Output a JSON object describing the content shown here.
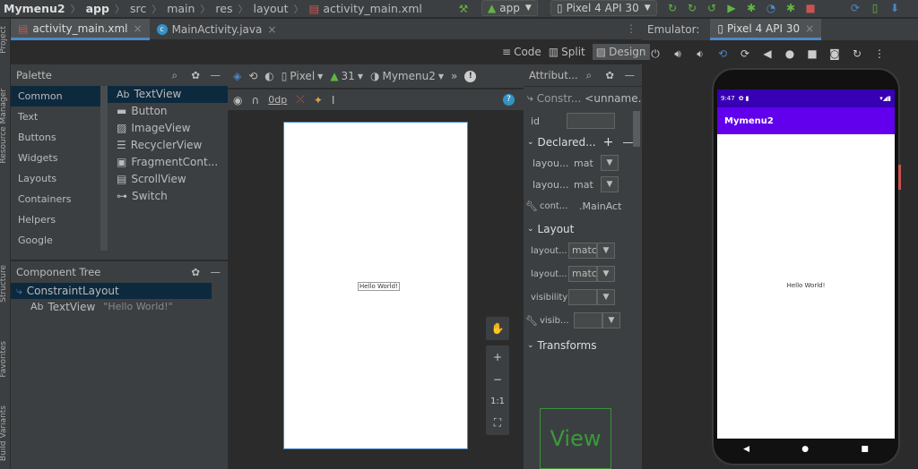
{
  "breadcrumb": {
    "project": "Mymenu2",
    "module": "app",
    "src": "src",
    "main": "main",
    "res": "res",
    "layout": "layout",
    "file": "activity_main.xml"
  },
  "run_config": "app",
  "device": "Pixel 4 API 30",
  "editor_tabs": [
    {
      "label": "activity_main.xml"
    },
    {
      "label": "MainActivity.java"
    }
  ],
  "view_modes": {
    "code": "Code",
    "split": "Split",
    "design": "Design"
  },
  "emulator": {
    "label": "Emulator:",
    "tab": "Pixel 4 API 30"
  },
  "side_labels": {
    "project": "Project",
    "resource_manager": "Resource Manager",
    "structure": "Structure",
    "favorites": "Favorites",
    "build_variants": "Build Variants"
  },
  "palette": {
    "title": "Palette",
    "categories": [
      "Common",
      "Text",
      "Buttons",
      "Widgets",
      "Layouts",
      "Containers",
      "Helpers",
      "Google"
    ],
    "items": [
      {
        "prefix": "Ab",
        "label": "TextView"
      },
      {
        "label": "Button"
      },
      {
        "label": "ImageView"
      },
      {
        "label": "RecyclerView"
      },
      {
        "label": "FragmentCont..."
      },
      {
        "label": "ScrollView"
      },
      {
        "label": "Switch"
      }
    ]
  },
  "component_tree": {
    "title": "Component Tree",
    "root": "ConstraintLayout",
    "child_prefix": "Ab",
    "child": "TextView",
    "child_value": "\"Hello World!\""
  },
  "design_toolbar": {
    "device": "Pixel",
    "api": "31",
    "theme": "Mymenu2",
    "margin": "0dp"
  },
  "canvas": {
    "hello": "Hello World!"
  },
  "zoom": {
    "fit": "1:1"
  },
  "attributes": {
    "title": "Attribut...",
    "class": "Constr...",
    "id_name": "<unname...",
    "id_label": "id",
    "declared_title": "Declared...",
    "declared": [
      {
        "label": "layou...",
        "value": "mat"
      },
      {
        "label": "layou...",
        "value": "mat"
      },
      {
        "label": "cont...",
        "value": ".MainAct"
      }
    ],
    "layout_title": "Layout",
    "layout": [
      {
        "label": "layout...",
        "value": "matc"
      },
      {
        "label": "layout...",
        "value": "matc"
      },
      {
        "label": "visibility",
        "value": ""
      },
      {
        "label": "visib...",
        "value": ""
      }
    ],
    "transforms_title": "Transforms",
    "view_preview": "View"
  },
  "phone": {
    "time": "9:47",
    "app_title": "Mymenu2",
    "hello": "Hello World!"
  },
  "colors": {
    "accent": "#4a88c7",
    "app_bar": "#6200ee",
    "status_bar": "#3700b3"
  }
}
